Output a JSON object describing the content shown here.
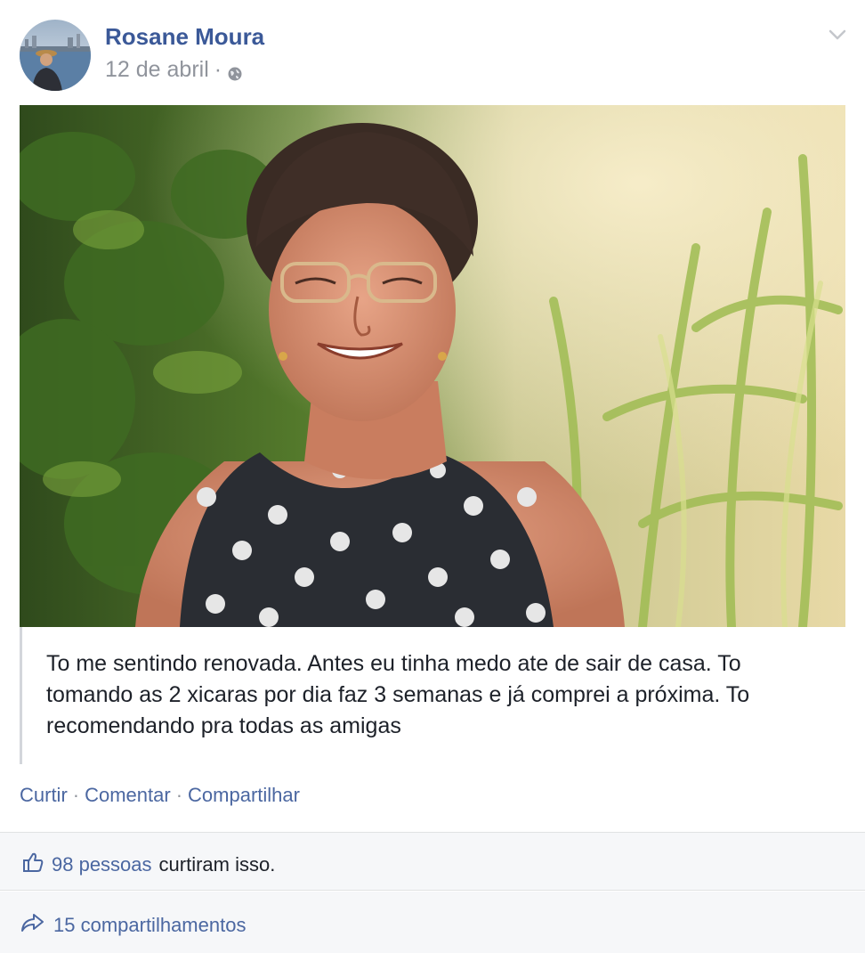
{
  "post": {
    "author": "Rosane Moura",
    "date": "12 de abril",
    "date_separator": "·",
    "privacy_icon": "globe-icon",
    "menu_icon": "chevron-down-icon",
    "photo_alt": "",
    "quote": "To me sentindo renovada. Antes eu tinha medo ate de sair de casa. To tomando as 2 xicaras por dia faz 3 semanas e já comprei a próxima. To recomendando pra todas as amigas"
  },
  "actions": {
    "like": "Curtir",
    "comment": "Comentar",
    "share": "Compartilhar",
    "separator": "·"
  },
  "likes": {
    "icon": "thumbs-up-icon",
    "count_text": "98 pessoas",
    "suffix": "curtiram isso."
  },
  "shares": {
    "icon": "share-arrow-icon",
    "text": "15 compartilhamentos"
  },
  "colors": {
    "link": "#4b67a1",
    "author": "#3b5998",
    "muted": "#90949c",
    "footer_bg": "#f6f7f9"
  }
}
